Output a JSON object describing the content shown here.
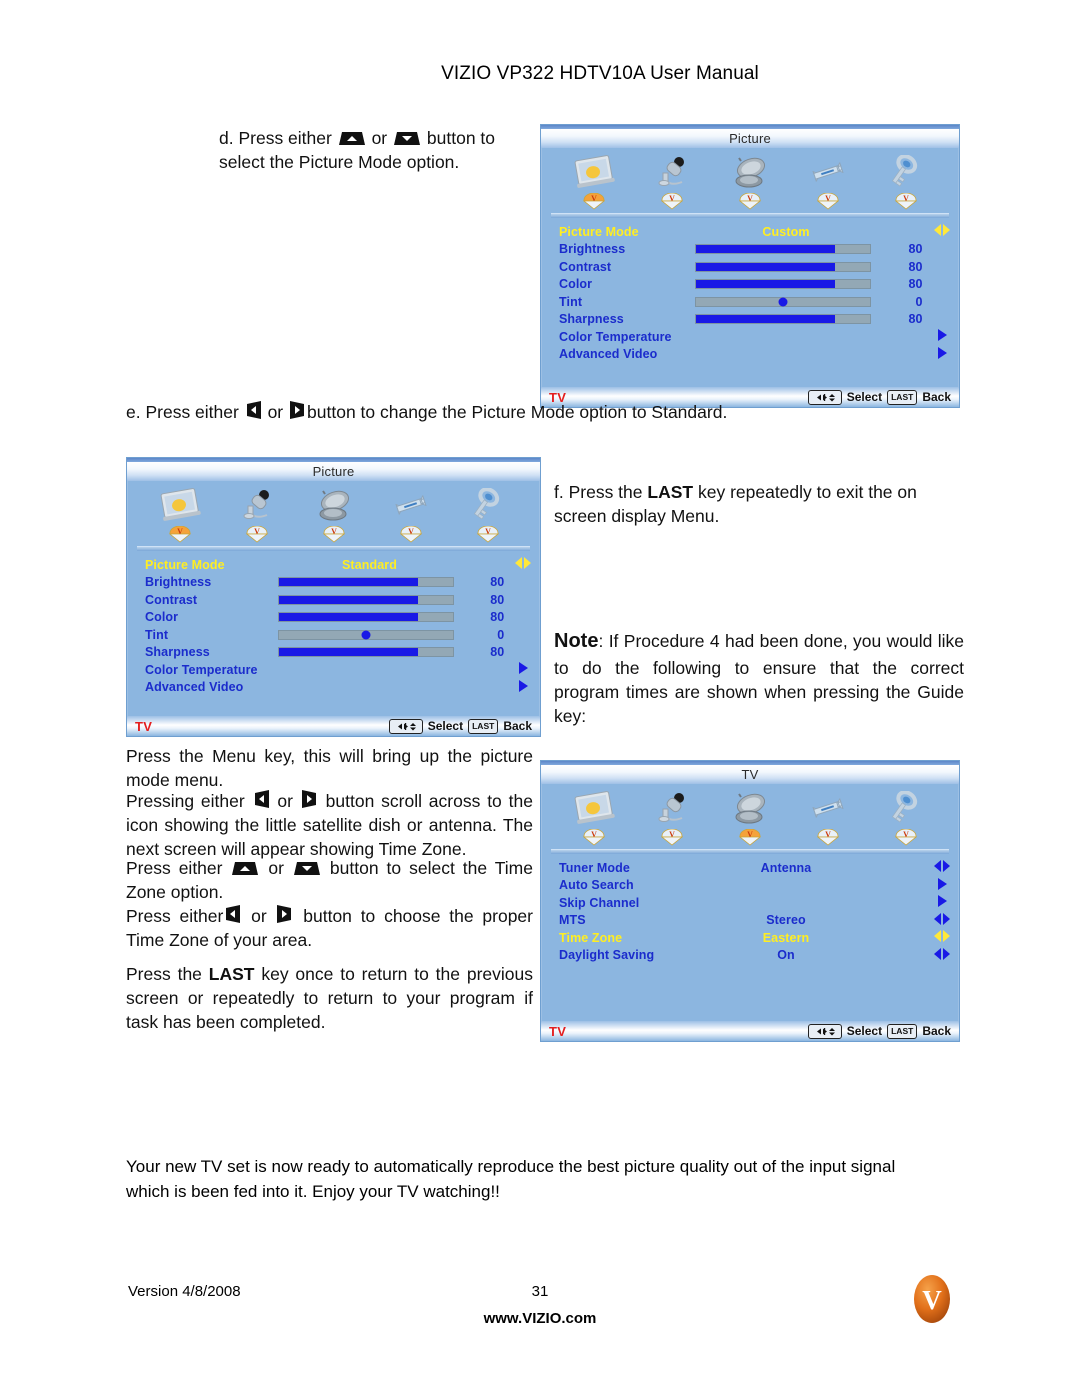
{
  "header": {
    "title": "VIZIO VP322 HDTV10A User Manual"
  },
  "steps": {
    "d_pre": "d. Press either",
    "d_or": "or",
    "d_post": "button to",
    "d_line2": "select the Picture Mode option.",
    "e_pre": "e. Press either",
    "e_or": "or",
    "e_post": "button to change the Picture Mode option to Standard.",
    "f_pre": "f. Press the",
    "f_key": "LAST",
    "f_post": "key repeatedly to exit the on",
    "f_line2": "screen display Menu."
  },
  "note": {
    "label": "Note",
    "text": ": If Procedure 4 had been done, you would like to do the following to ensure that the correct program times are shown when pressing the Guide key:"
  },
  "left_instructions": {
    "p1": "Press the Menu key, this will bring up the picture mode menu.",
    "p2_pre": "Pressing either",
    "p2_or": "or",
    "p2_post": "button scroll across to the icon showing the little satellite dish or antenna. The next screen will appear showing Time Zone.",
    "p3_pre": "Press either",
    "p3_or": "or",
    "p3_post": "button to select the Time Zone option.",
    "p4_pre": "Press either",
    "p4_or": "or",
    "p4_post": "button to choose the proper Time Zone of your area.",
    "p5_pre": "Press the",
    "p5_key": "LAST",
    "p5_post": "key once to return to the previous screen or repeatedly to return to your program if task has been completed."
  },
  "closing": "Your new TV set is now ready to automatically reproduce the best picture quality out of the input signal which is been fed into it. Enjoy your TV watching!!",
  "footer": {
    "version": "Version 4/8/2008",
    "page": "31",
    "url": "www.VIZIO.com",
    "logo_letter": "V"
  },
  "osd_common": {
    "icons": [
      {
        "name": "picture-monitor-icon",
        "badge": "V"
      },
      {
        "name": "microphone-icon",
        "badge": "V"
      },
      {
        "name": "satellite-dish-icon",
        "badge": "V"
      },
      {
        "name": "wrench-icon",
        "badge": "V"
      },
      {
        "name": "key-icon",
        "badge": "V"
      }
    ],
    "status": {
      "tv": "TV",
      "select": "Select",
      "last": "LAST",
      "back": "Back"
    }
  },
  "osd_picture_custom": {
    "title": "Picture",
    "active_icon": 0,
    "rows": [
      {
        "label": "Picture Mode",
        "value": "Custom",
        "type": "option",
        "selected": true,
        "arrow": "leftright-yellow"
      },
      {
        "label": "Brightness",
        "value": "80",
        "type": "bar",
        "pct": 80,
        "selected": false,
        "arrow": ""
      },
      {
        "label": "Contrast",
        "value": "80",
        "type": "bar",
        "pct": 80,
        "selected": false,
        "arrow": ""
      },
      {
        "label": "Color",
        "value": "80",
        "type": "bar",
        "pct": 80,
        "selected": false,
        "arrow": ""
      },
      {
        "label": "Tint",
        "value": "0",
        "type": "center",
        "pct": 50,
        "selected": false,
        "arrow": ""
      },
      {
        "label": "Sharpness",
        "value": "80",
        "type": "bar",
        "pct": 80,
        "selected": false,
        "arrow": ""
      },
      {
        "label": "Color Temperature",
        "value": "",
        "type": "submenu",
        "selected": false,
        "arrow": "right-blue"
      },
      {
        "label": "Advanced Video",
        "value": "",
        "type": "submenu",
        "selected": false,
        "arrow": "right-blue"
      }
    ]
  },
  "osd_picture_standard": {
    "title": "Picture",
    "active_icon": 0,
    "rows": [
      {
        "label": "Picture Mode",
        "value": "Standard",
        "type": "option",
        "selected": true,
        "arrow": "leftright-yellow"
      },
      {
        "label": "Brightness",
        "value": "80",
        "type": "bar",
        "pct": 80,
        "selected": false,
        "arrow": ""
      },
      {
        "label": "Contrast",
        "value": "80",
        "type": "bar",
        "pct": 80,
        "selected": false,
        "arrow": ""
      },
      {
        "label": "Color",
        "value": "80",
        "type": "bar",
        "pct": 80,
        "selected": false,
        "arrow": ""
      },
      {
        "label": "Tint",
        "value": "0",
        "type": "center",
        "pct": 50,
        "selected": false,
        "arrow": ""
      },
      {
        "label": "Sharpness",
        "value": "80",
        "type": "bar",
        "pct": 80,
        "selected": false,
        "arrow": ""
      },
      {
        "label": "Color Temperature",
        "value": "",
        "type": "submenu",
        "selected": false,
        "arrow": "right-blue"
      },
      {
        "label": "Advanced Video",
        "value": "",
        "type": "submenu",
        "selected": false,
        "arrow": "right-blue"
      }
    ]
  },
  "osd_tv": {
    "title": "TV",
    "active_icon": 2,
    "rows": [
      {
        "label": "Tuner Mode",
        "value": "Antenna",
        "type": "option",
        "selected": false,
        "arrow": "leftright-blue"
      },
      {
        "label": "Auto Search",
        "value": "",
        "type": "submenu",
        "selected": false,
        "arrow": "right-blue"
      },
      {
        "label": "Skip Channel",
        "value": "",
        "type": "submenu",
        "selected": false,
        "arrow": "right-blue"
      },
      {
        "label": "MTS",
        "value": "Stereo",
        "type": "option",
        "selected": false,
        "arrow": "leftright-blue"
      },
      {
        "label": "Time Zone",
        "value": "Eastern",
        "type": "option",
        "selected": true,
        "arrow": "leftright-yellow"
      },
      {
        "label": "Daylight Saving",
        "value": "On",
        "type": "option",
        "selected": false,
        "arrow": "leftright-blue"
      }
    ]
  },
  "colors": {
    "osd_bg": "#8cb6e0",
    "osd_label": "#1b2ccc",
    "osd_selected": "#ffee22",
    "bar_fill": "#1919e6",
    "bar_track": "#93a8b5",
    "tv_red": "#e41e1e",
    "vizio_orange": "#e2701a"
  }
}
